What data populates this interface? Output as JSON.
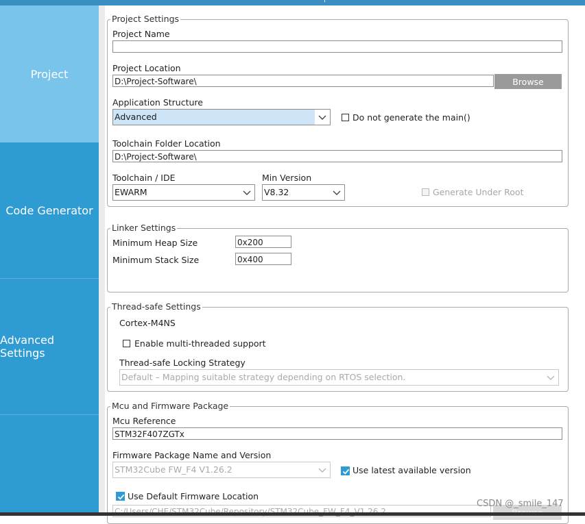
{
  "sidebar": {
    "items": [
      {
        "label": "Project",
        "active": true
      },
      {
        "label": "Code Generator",
        "active": false
      },
      {
        "label": "Advanced Settings",
        "active": false
      }
    ]
  },
  "project_settings": {
    "title": "Project Settings",
    "project_name_label": "Project Name",
    "project_name_value": "",
    "project_location_label": "Project Location",
    "project_location_value": "D:\\Project-Software\\",
    "browse_label": "Browse",
    "app_structure_label": "Application Structure",
    "app_structure_value": "Advanced",
    "no_main_label": "Do not generate the main()",
    "toolchain_folder_label": "Toolchain Folder Location",
    "toolchain_folder_value": "D:\\Project-Software\\",
    "toolchain_label": "Toolchain / IDE",
    "toolchain_value": "EWARM",
    "min_version_label": "Min Version",
    "min_version_value": "V8.32",
    "generate_under_root_label": "Generate Under Root"
  },
  "linker_settings": {
    "title": "Linker Settings",
    "heap_label": "Minimum Heap Size",
    "heap_value": "0x200",
    "stack_label": "Minimum Stack Size",
    "stack_value": "0x400"
  },
  "thread_safe": {
    "title": "Thread-safe Settings",
    "core_label": "Cortex-M4NS",
    "multithread_label": "Enable multi-threaded support",
    "strategy_label": "Thread-safe Locking Strategy",
    "strategy_value": "Default  –  Mapping suitable strategy depending on RTOS selection."
  },
  "mcu_firmware": {
    "title": "Mcu and Firmware Package",
    "mcu_ref_label": "Mcu Reference",
    "mcu_ref_value": "STM32F407ZGTx",
    "fw_name_label": "Firmware Package Name and Version",
    "fw_name_value": "STM32Cube FW_F4 V1.26.2",
    "use_latest_label": "Use latest available version",
    "use_default_location_label": "Use Default Firmware Location",
    "fw_location_value": "C:/Users/CHE/STM32Cube/Repository/STM32Cube_FW_F4_V1.26.2",
    "fw_browse_label": "Browse"
  },
  "watermark": "CSDN @_smile_147",
  "colors": {
    "sidebar": "#2f9bd3",
    "sidebar_active": "#79c4ea",
    "accent": "#2f9bd3",
    "button": "#9a9a9a"
  }
}
